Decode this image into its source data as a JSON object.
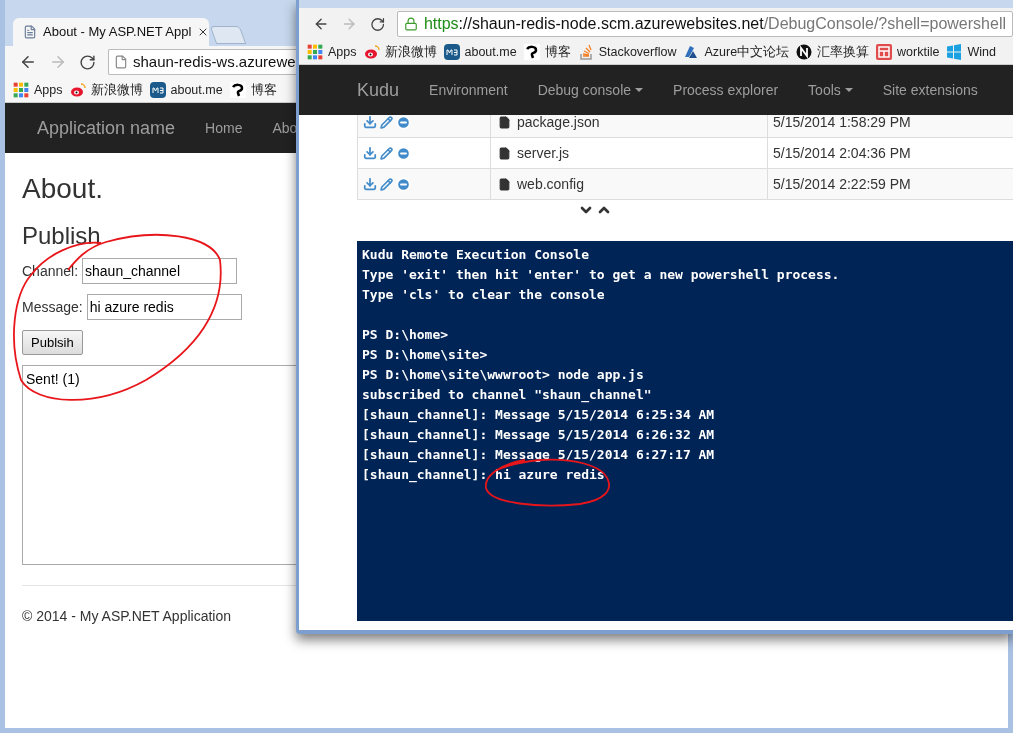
{
  "back_window": {
    "tab": {
      "title": "About - My ASP.NET Appl"
    },
    "address": "shaun-redis-ws.azurewe",
    "bookmarks": [
      {
        "label": "Apps",
        "kind": "apps"
      },
      {
        "label": "新浪微博",
        "kind": "weibo"
      },
      {
        "label": "about.me",
        "kind": "me"
      },
      {
        "label": "博客",
        "kind": "blog"
      }
    ],
    "navbar": {
      "brand": "Application name",
      "links": [
        "Home",
        "Abo"
      ]
    },
    "page": {
      "heading": "About.",
      "subheading": "Publish",
      "fields": [
        {
          "label": "Channel:",
          "value": "shaun_channel"
        },
        {
          "label": "Message:",
          "value": "hi azure redis"
        }
      ],
      "button": "Publsih",
      "output": "Sent! (1)",
      "footer": "© 2014 - My ASP.NET Application"
    }
  },
  "front_window": {
    "address": {
      "scheme": "https",
      "host": "://shaun-redis-node.scm.azurewebsites.net",
      "path": "/DebugConsole/?shell=powershell"
    },
    "bookmarks": [
      {
        "label": "Apps",
        "kind": "apps"
      },
      {
        "label": "新浪微博",
        "kind": "weibo"
      },
      {
        "label": "about.me",
        "kind": "me"
      },
      {
        "label": "博客",
        "kind": "blog"
      },
      {
        "label": "Stackoverflow",
        "kind": "stack"
      },
      {
        "label": "Azure中文论坛",
        "kind": "azure"
      },
      {
        "label": "汇率换算",
        "kind": "n"
      },
      {
        "label": "worktile",
        "kind": "worktile"
      },
      {
        "label": "Wind",
        "kind": "windows"
      }
    ],
    "navbar": {
      "brand": "Kudu",
      "links": [
        {
          "label": "Environment",
          "dropdown": false
        },
        {
          "label": "Debug console",
          "dropdown": true
        },
        {
          "label": "Process explorer",
          "dropdown": false
        },
        {
          "label": "Tools",
          "dropdown": true
        },
        {
          "label": "Site extensions",
          "dropdown": false
        }
      ]
    },
    "files": [
      {
        "name": "package.json",
        "modified": "5/15/2014 1:58:29 PM"
      },
      {
        "name": "server.js",
        "modified": "5/15/2014 2:04:36 PM"
      },
      {
        "name": "web.config",
        "modified": "5/15/2014 2:22:59 PM"
      }
    ],
    "console": {
      "banner": [
        "Kudu Remote Execution Console",
        "Type 'exit' then hit 'enter' to get a new powershell process.",
        "Type 'cls' to clear the console"
      ],
      "session": [
        "PS D:\\home>",
        "PS D:\\home\\site>",
        "PS D:\\home\\site\\wwwroot> node app.js",
        "subscribed to channel \"shaun_channel\"",
        "[shaun_channel]: Message 5/15/2014 6:25:34 AM",
        "[shaun_channel]: Message 5/15/2014 6:26:32 AM",
        "[shaun_channel]: Message 5/15/2014 6:27:17 AM",
        "[shaun_channel]: hi azure redis"
      ]
    }
  }
}
